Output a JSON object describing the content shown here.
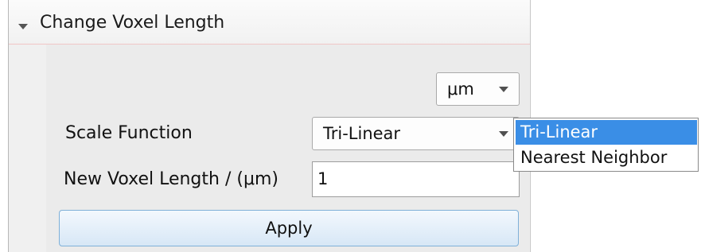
{
  "panel": {
    "title": "Change Voxel Length",
    "unit_select": {
      "value": "μm"
    },
    "scale_function": {
      "label": "Scale Function",
      "value": "Tri-Linear",
      "options": [
        "Tri-Linear",
        "Nearest Neighbor"
      ],
      "highlighted": "Tri-Linear"
    },
    "voxel_length": {
      "label": "New Voxel Length / (μm)",
      "value": "1"
    },
    "apply_label": "Apply"
  },
  "colors": {
    "selection": "#3a8ee6",
    "apply_border": "#7fb0d8",
    "header_divider": "#f1c6c6"
  },
  "icons": [
    "collapse-arrow-icon",
    "chevron-down-icon"
  ]
}
